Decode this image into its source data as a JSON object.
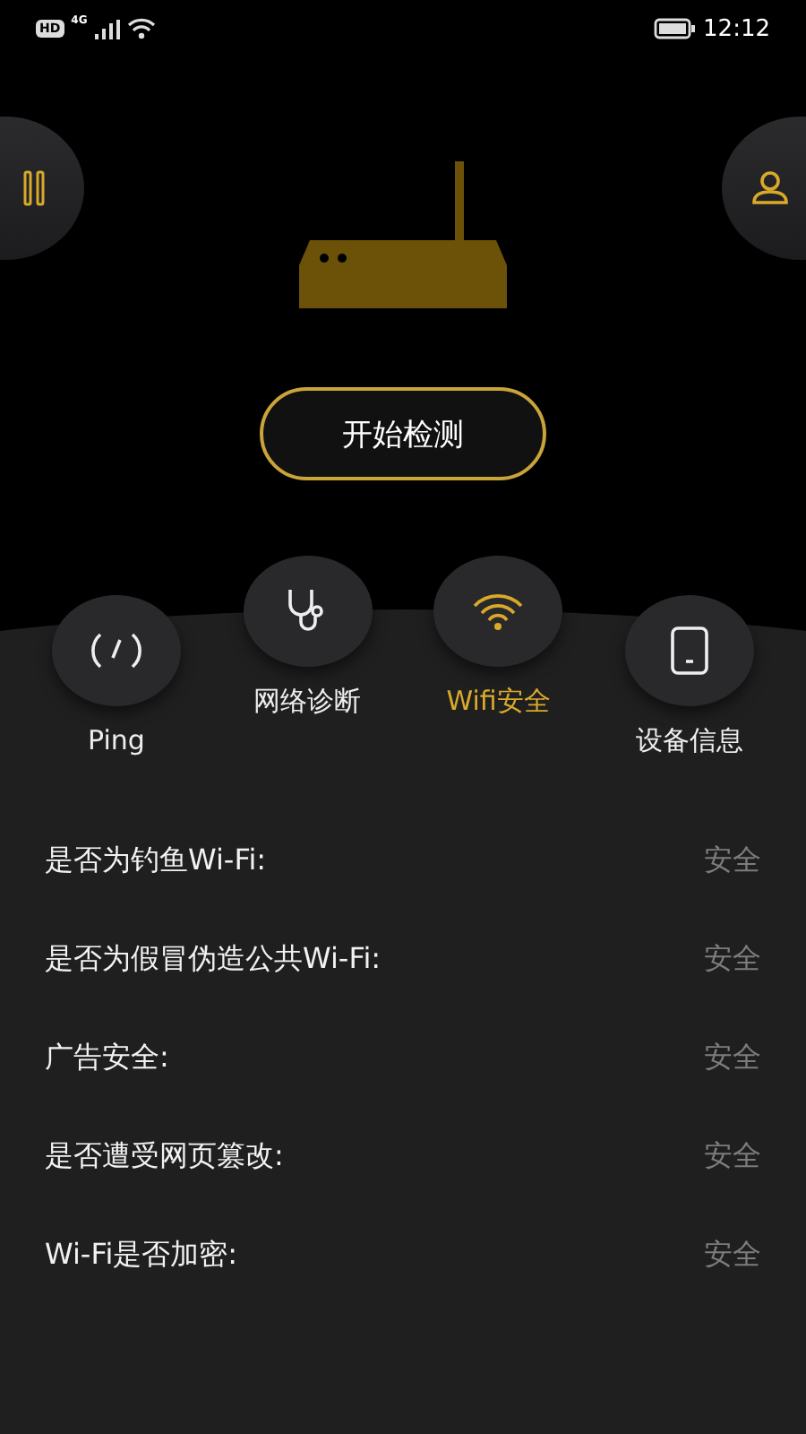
{
  "status_bar": {
    "hd": "HD",
    "network": "4G",
    "time": "12:12"
  },
  "start_button": {
    "label": "开始检测"
  },
  "tabs": [
    {
      "label": "Ping",
      "kind": "gauge",
      "selected": false
    },
    {
      "label": "网络诊断",
      "kind": "stethoscope",
      "selected": false
    },
    {
      "label": "Wifi安全",
      "kind": "wifi",
      "selected": true
    },
    {
      "label": "设备信息",
      "kind": "device",
      "selected": false
    }
  ],
  "checks": [
    {
      "label": "是否为钓鱼Wi-Fi:",
      "result": "安全"
    },
    {
      "label": "是否为假冒伪造公共Wi-Fi:",
      "result": "安全"
    },
    {
      "label": "广告安全:",
      "result": "安全"
    },
    {
      "label": "是否遭受网页篡改:",
      "result": "安全"
    },
    {
      "label": "Wi-Fi是否加密:",
      "result": "安全"
    }
  ]
}
